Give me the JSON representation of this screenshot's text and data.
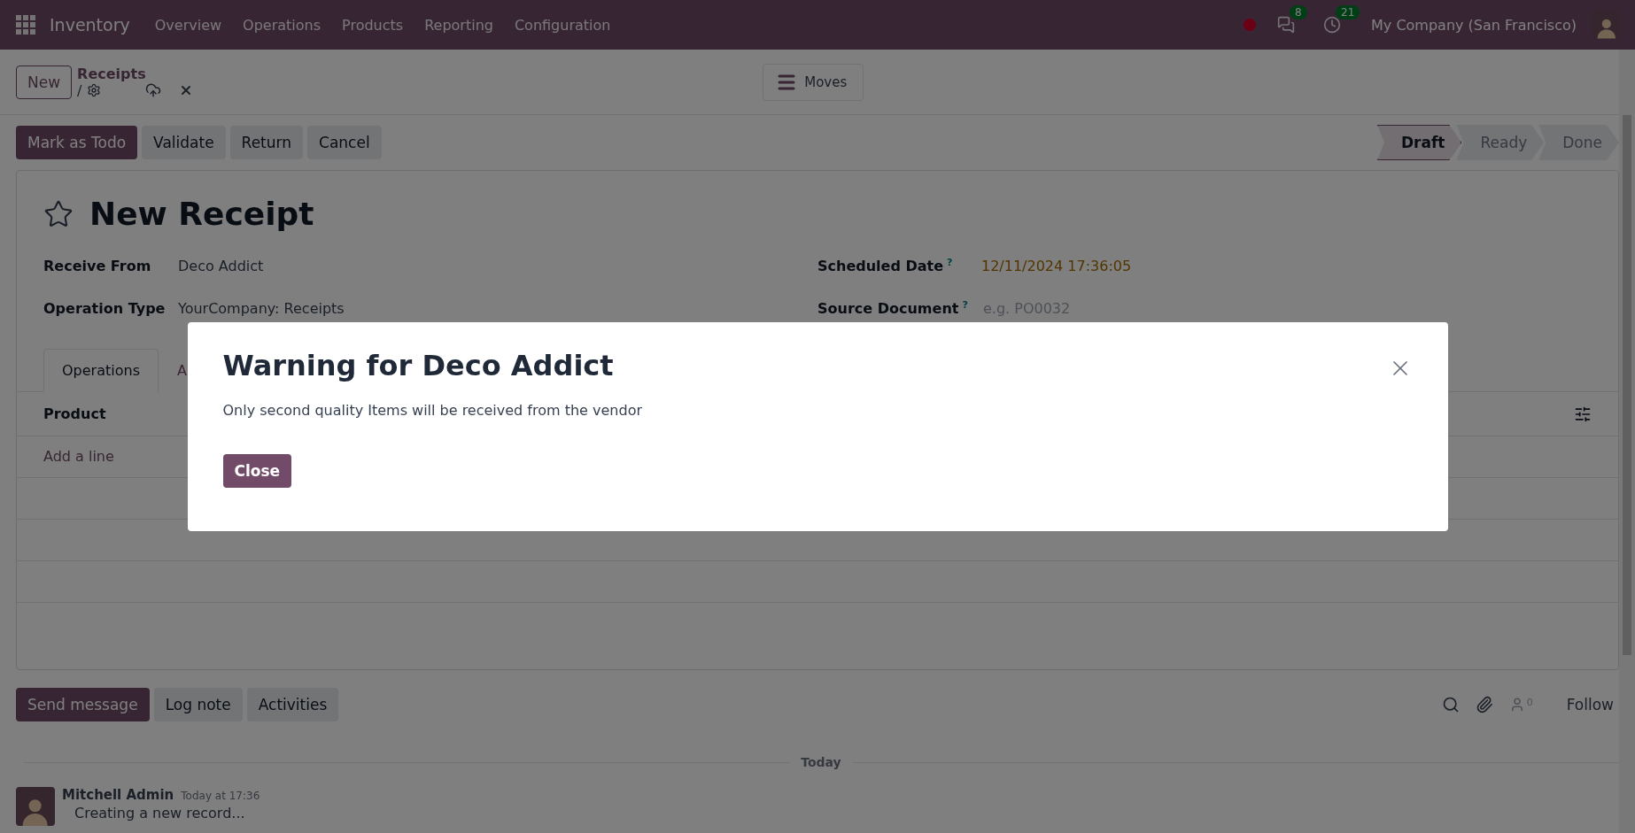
{
  "navbar": {
    "app_name": "Inventory",
    "menu": [
      "Overview",
      "Operations",
      "Products",
      "Reporting",
      "Configuration"
    ],
    "messages_badge": "8",
    "activities_badge": "21",
    "company": "My Company (San Francisco)"
  },
  "control_panel": {
    "new_button": "New",
    "breadcrumb": "Receipts",
    "separator": "/",
    "smart_button": "Moves"
  },
  "action_buttons": [
    {
      "label": "Mark as Todo",
      "kind": "primary"
    },
    {
      "label": "Validate",
      "kind": "secondary"
    },
    {
      "label": "Return",
      "kind": "secondary"
    },
    {
      "label": "Cancel",
      "kind": "secondary"
    }
  ],
  "status_steps": [
    {
      "label": "Draft",
      "selected": true
    },
    {
      "label": "Ready",
      "selected": false
    },
    {
      "label": "Done",
      "selected": false
    }
  ],
  "form": {
    "title": "New Receipt",
    "fields_left": [
      {
        "label": "Receive From",
        "value": "Deco Addict"
      },
      {
        "label": "Operation Type",
        "value": "YourCompany: Receipts"
      }
    ],
    "fields_right": [
      {
        "label": "Scheduled Date",
        "help": "?",
        "value": "12/11/2024 17:36:05"
      },
      {
        "label": "Source Document",
        "help": "?",
        "placeholder": "e.g. PO0032"
      }
    ],
    "tabs": [
      {
        "label": "Operations",
        "selected": true
      },
      {
        "label": "A",
        "selected": false
      }
    ],
    "lines_table": {
      "columns": [
        "Product"
      ],
      "add_line": "Add a line"
    }
  },
  "chatter": {
    "buttons": [
      {
        "label": "Send message",
        "kind": "primary"
      },
      {
        "label": "Log note",
        "kind": "secondary"
      },
      {
        "label": "Activities",
        "kind": "secondary"
      }
    ],
    "followers_count": "0",
    "follow": "Follow",
    "date_separator": "Today",
    "messages": [
      {
        "author": "Mitchell Admin",
        "time": "Today at 17:36",
        "body": "Creating a new record..."
      }
    ]
  },
  "dialog": {
    "title": "Warning for Deco Addict",
    "body": "Only second quality Items will be received from the vendor",
    "button": "Close"
  }
}
